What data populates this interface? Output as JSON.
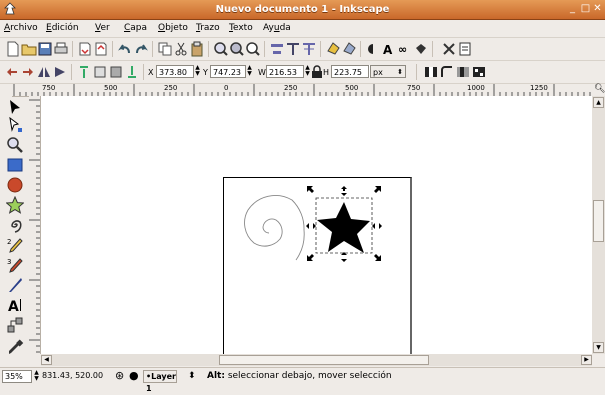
{
  "window": {
    "title": "Nuevo documento 1 - Inkscape",
    "minimize": "_",
    "maximize": "□",
    "close": "✕"
  },
  "menu": [
    {
      "pre": "",
      "u": "A",
      "post": "rchivo"
    },
    {
      "pre": "",
      "u": "E",
      "post": "dición"
    },
    {
      "pre": "",
      "u": "V",
      "post": "er"
    },
    {
      "pre": "",
      "u": "C",
      "post": "apa"
    },
    {
      "pre": "",
      "u": "O",
      "post": "bjeto"
    },
    {
      "pre": "",
      "u": "T",
      "post": "razo"
    },
    {
      "pre": "",
      "u": "T",
      "post": "exto"
    },
    {
      "pre": "Ay",
      "u": "u",
      "post": "da"
    }
  ],
  "controls": {
    "x_label": "X",
    "x_value": "373.80",
    "y_label": "Y",
    "y_value": "747.23",
    "w_label": "W",
    "w_value": "216.53",
    "h_label": "H",
    "h_value": "223.75",
    "unit": "px"
  },
  "ruler": {
    "marks": [
      "750",
      "500",
      "250",
      "0",
      "250",
      "500",
      "750",
      "1000",
      "1250"
    ]
  },
  "status": {
    "zoom": "35%",
    "coords": "831.43, 520.00",
    "layer": "•Layer 1",
    "message_bold": "Alt:",
    "message": " seleccionar debajo, mover selección"
  },
  "colors": {
    "titlebar": "#d97b3c",
    "selection": "#000000"
  }
}
